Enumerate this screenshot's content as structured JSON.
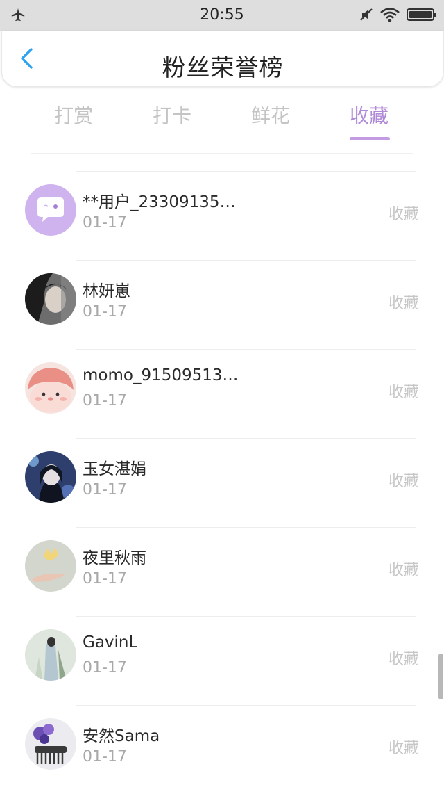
{
  "status_bar": {
    "time": "20:55",
    "icons": [
      "airplane-icon",
      "mute-icon",
      "wifi-icon",
      "battery-icon"
    ]
  },
  "header": {
    "title": "粉丝荣誉榜",
    "back_icon": "chevron-left-icon"
  },
  "tabs": [
    {
      "label": "打赏",
      "active": false
    },
    {
      "label": "打卡",
      "active": false
    },
    {
      "label": "鲜花",
      "active": false
    },
    {
      "label": "收藏",
      "active": true
    }
  ],
  "colors": {
    "accent": "#c39be3",
    "active_tab_text": "#b08ad6",
    "back_arrow": "#2ea3f2",
    "muted_text": "#c4c4c4"
  },
  "list": [
    {
      "name": "**用户_23309135…",
      "date": "01-17",
      "action": "收藏",
      "avatar": "chat-bubble-avatar"
    },
    {
      "name": "林妍崽",
      "date": "01-17",
      "action": "收藏",
      "avatar": "photo-avatar"
    },
    {
      "name": "momo_91509513…",
      "date": "01-17",
      "action": "收藏",
      "avatar": "cartoon-avatar"
    },
    {
      "name": "玉女湛娟",
      "date": "01-17",
      "action": "收藏",
      "avatar": "photo-avatar"
    },
    {
      "name": "夜里秋雨",
      "date": "01-17",
      "action": "收藏",
      "avatar": "photo-avatar"
    },
    {
      "name": "GavinL",
      "date": "01-17",
      "action": "收藏",
      "avatar": "photo-avatar"
    },
    {
      "name": "安然Sama",
      "date": "01-17",
      "action": "收藏",
      "avatar": "photo-avatar"
    }
  ]
}
